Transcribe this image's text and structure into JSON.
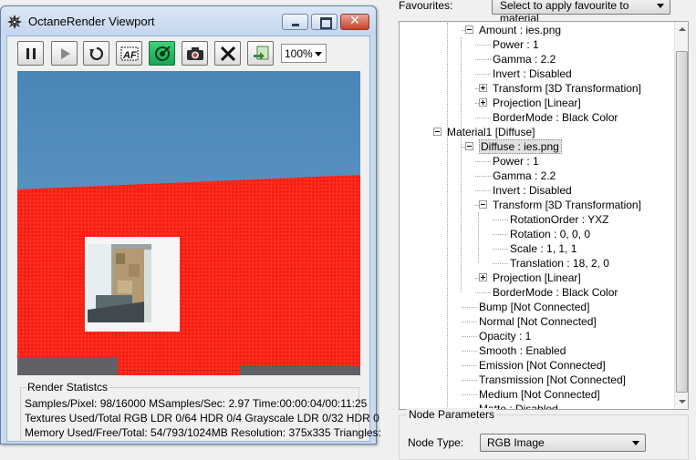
{
  "viewport": {
    "title": "OctaneRender Viewport",
    "zoom": "100%",
    "colors": {
      "sky": "#4d87b8",
      "wall": "#ff2a1e",
      "floor": "#5e6066"
    },
    "toolbar": [
      {
        "name": "pause-button",
        "icon": "pause-icon"
      },
      {
        "name": "play-button",
        "icon": "play-icon"
      },
      {
        "name": "restart-button",
        "icon": "reload-icon"
      },
      {
        "name": "autofocus-button",
        "icon": "af-icon"
      },
      {
        "name": "viewpoint-button",
        "icon": "target-icon",
        "active": true
      },
      {
        "name": "snapshot-button",
        "icon": "camera-icon"
      },
      {
        "name": "stop-button",
        "icon": "x-icon"
      },
      {
        "name": "export-button",
        "icon": "export-icon"
      }
    ],
    "stats": {
      "title": "Render Statistcs",
      "line1": "Samples/Pixel: 98/16000  MSamples/Sec: 2.97  Time:00:00:04/00:11:25",
      "line2": "Textures Used/Total RGB LDR 0/64  HDR 0/4  Grayscale LDR 0/32  HDR 0",
      "line3": "Memory Used/Free/Total: 54/793/1024MB  Resolution: 375x335  Triangles:"
    }
  },
  "favourites": {
    "label": "Favourites:",
    "selected": "Select to apply favourite to material"
  },
  "tree": {
    "items": [
      {
        "text": "Amount : ies.png",
        "level": 1,
        "expander": "minus"
      },
      {
        "text": "Power : 1",
        "level": 2
      },
      {
        "text": "Gamma : 2.2",
        "level": 2
      },
      {
        "text": "Invert : Disabled",
        "level": 2
      },
      {
        "text": "Transform  [3D Transformation]",
        "level": 2,
        "expander": "plus"
      },
      {
        "text": "Projection  [Linear]",
        "level": 2,
        "expander": "plus"
      },
      {
        "text": "BorderMode : Black Color",
        "level": 2
      },
      {
        "text": "Material1  [Diffuse]",
        "level": 0,
        "expander": "minus"
      },
      {
        "text": "Diffuse : ies.png",
        "level": 1,
        "expander": "minus",
        "selected": true
      },
      {
        "text": "Power : 1",
        "level": 2
      },
      {
        "text": "Gamma : 2.2",
        "level": 2
      },
      {
        "text": "Invert : Disabled",
        "level": 2
      },
      {
        "text": "Transform  [3D Transformation]",
        "level": 2,
        "expander": "minus"
      },
      {
        "text": "RotationOrder : YXZ",
        "level": 3
      },
      {
        "text": "Rotation : 0, 0, 0",
        "level": 3
      },
      {
        "text": "Scale : 1, 1, 1",
        "level": 3
      },
      {
        "text": "Translation : 18, 2, 0",
        "level": 3
      },
      {
        "text": "Projection  [Linear]",
        "level": 2,
        "expander": "plus"
      },
      {
        "text": "BorderMode : Black Color",
        "level": 2
      },
      {
        "text": "Bump  [Not Connected]",
        "level": 1
      },
      {
        "text": "Normal  [Not Connected]",
        "level": 1
      },
      {
        "text": "Opacity : 1",
        "level": 1
      },
      {
        "text": "Smooth : Enabled",
        "level": 1
      },
      {
        "text": "Emission  [Not Connected]",
        "level": 1
      },
      {
        "text": "Transmission  [Not Connected]",
        "level": 1
      },
      {
        "text": "Medium  [Not Connected]",
        "level": 1
      },
      {
        "text": "Matte : Disabled",
        "level": 1
      }
    ]
  },
  "node_params": {
    "title": "Node Parameters",
    "type_label": "Node Type:",
    "type_value": "RGB Image"
  }
}
